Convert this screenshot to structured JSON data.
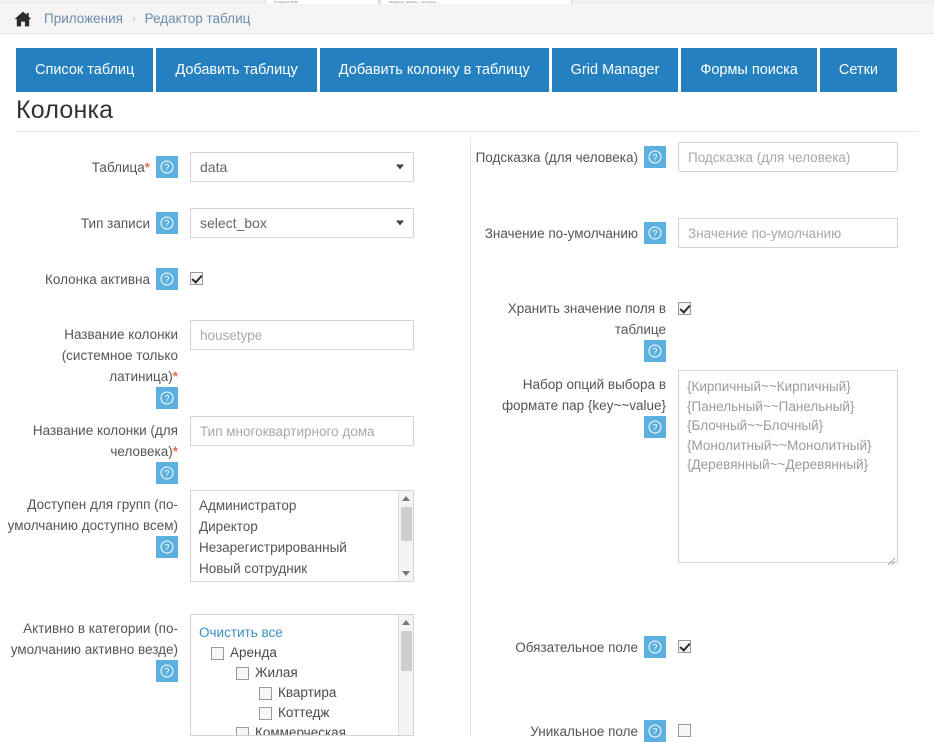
{
  "browser": {
    "tabs": [
      {
        "label": "Отладчик PHP"
      },
      {
        "label": "Редактор таблиц — Колонка"
      }
    ]
  },
  "breadcrumb": {
    "home_icon": "home-icon",
    "separator": "›",
    "items": [
      {
        "label": "Приложения"
      },
      {
        "label": "Редактор таблиц"
      }
    ]
  },
  "tabs": [
    {
      "label": "Список таблиц"
    },
    {
      "label": "Добавить таблицу"
    },
    {
      "label": "Добавить колонку в таблицу"
    },
    {
      "label": "Grid Manager"
    },
    {
      "label": "Формы поиска"
    },
    {
      "label": "Сетки"
    }
  ],
  "page": {
    "title": "Колонка"
  },
  "left_column": {
    "table": {
      "label": "Таблица",
      "required_mark": "*",
      "help": "?",
      "value": "select-table",
      "selected": "data"
    },
    "record_type": {
      "label": "Тип записи",
      "help": "?",
      "selected": "select_box"
    },
    "column_active": {
      "label": "Колонка активна",
      "help": "?",
      "checked": true
    },
    "system_name": {
      "label": "Название колонки (системное только латиница)",
      "required_mark": "*",
      "help": "?",
      "placeholder": "housetype"
    },
    "human_name": {
      "label": "Название колонки (для человека)",
      "required_mark": "*",
      "help": "?",
      "placeholder": "Тип многоквартирного дома"
    },
    "groups": {
      "label": "Доступен для групп (по-умолчанию доступно всем)",
      "help": "?",
      "options": [
        "Администратор",
        "Директор",
        "Незарегистрированный",
        "Новый сотрудник"
      ]
    },
    "categories": {
      "label": "Активно в категории (по-умолчанию активно везде)",
      "help": "?",
      "clear_all": "Очистить все",
      "tree": [
        {
          "label": "Аренда",
          "level": 0,
          "checked": false
        },
        {
          "label": "Жилая",
          "level": 1,
          "checked": false
        },
        {
          "label": "Квартира",
          "level": 2,
          "checked": false
        },
        {
          "label": "Коттедж",
          "level": 2,
          "checked": false
        },
        {
          "label": "Коммерческая",
          "level": 1,
          "checked": false
        }
      ]
    }
  },
  "right_column": {
    "hint": {
      "label": "Подсказка (для человека)",
      "help": "?",
      "placeholder": "Подсказка (для человека)"
    },
    "default_value": {
      "label": "Значение по-умолчанию",
      "help": "?",
      "placeholder": "Значение по-умолчанию"
    },
    "store_value": {
      "label": "Хранить значение поля в таблице",
      "help": "?",
      "checked": true
    },
    "options_set": {
      "label": "Набор опций выбора в формате пар {key~~value}",
      "help": "?",
      "value": "{Кирпичный~~Кирпичный}\n{Панельный~~Панельный}\n{Блочный~~Блочный}\n{Монолитный~~Монолитный}\n{Деревянный~~Деревянный}"
    },
    "required_field": {
      "label": "Обязательное поле",
      "help": "?",
      "checked": true
    },
    "unique_field": {
      "label": "Уникальное поле",
      "help": "?",
      "checked": false
    }
  },
  "colors": {
    "tab_blue": "#2580c0",
    "help_blue": "#5bb0e0",
    "link_blue": "#3a8fc4",
    "crumb_blue": "#6b8cae",
    "required_red": "#e8705a",
    "border_gray": "#d4d4d4",
    "placeholder_gray": "#a8a8a8"
  }
}
